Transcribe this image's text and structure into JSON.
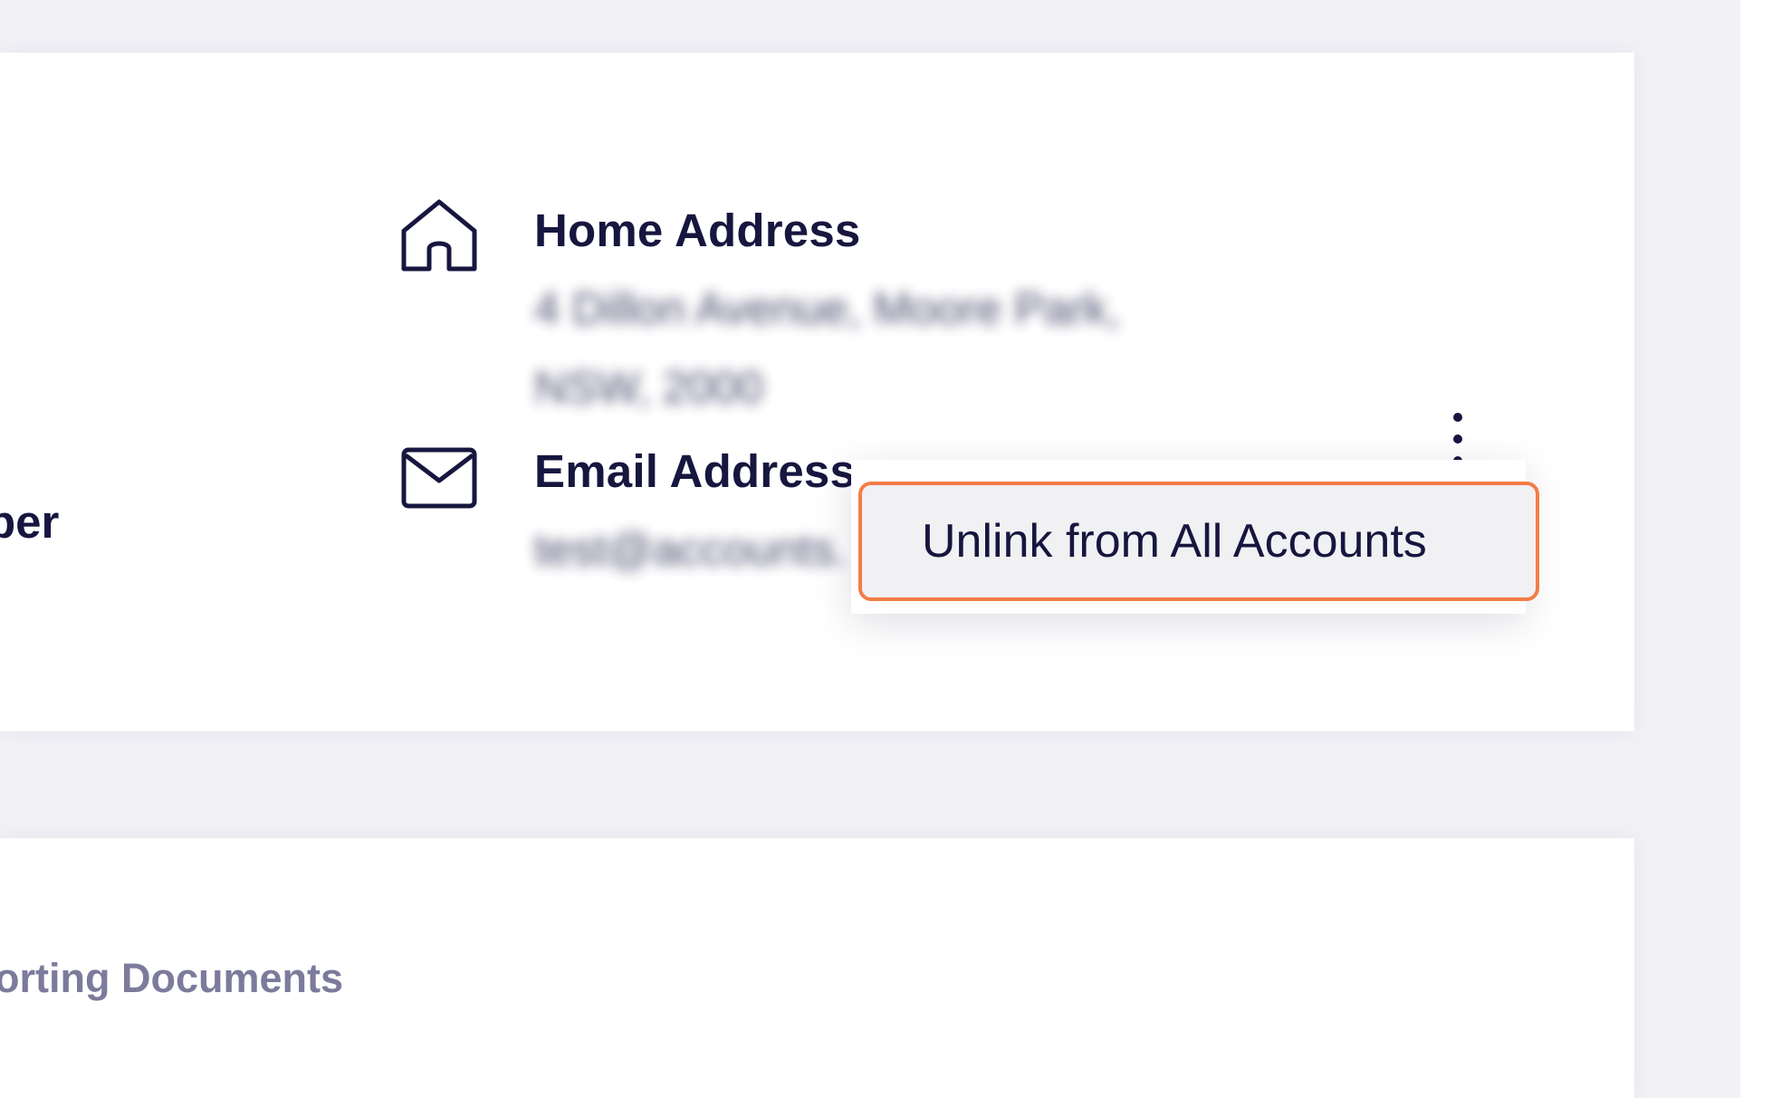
{
  "profile": {
    "partial_label_left": "ber",
    "home_address": {
      "icon": "home-icon",
      "label": "Home Address",
      "value_line1": "4 Dillon Avenue, Moore Park,",
      "value_line2": "NSW, 2000"
    },
    "email_address": {
      "icon": "mail-icon",
      "label": "Email Address",
      "value": "test@accounts."
    },
    "more_menu_icon": "vertical-ellipsis-icon"
  },
  "context_menu": {
    "items": [
      {
        "label": "Unlink from All Accounts"
      }
    ],
    "highlight_color": "#f47c47"
  },
  "documents": {
    "partial_label": "orting Documents"
  },
  "colors": {
    "text_primary": "#16163f",
    "text_muted": "#7c7b9c",
    "page_background": "#f1f1f6",
    "card_background": "#ffffff"
  }
}
